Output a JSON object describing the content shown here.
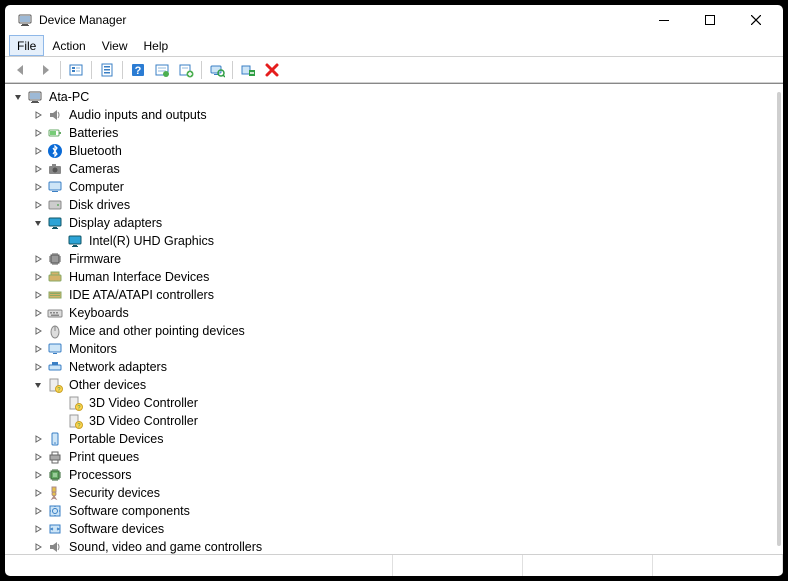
{
  "window": {
    "title": "Device Manager"
  },
  "menus": {
    "file": "File",
    "action": "Action",
    "view": "View",
    "help": "Help"
  },
  "toolbar_icons": [
    "back",
    "forward",
    "show-hidden",
    "properties",
    "help",
    "update",
    "add-legacy",
    "scan",
    "uninstall",
    "disable"
  ],
  "tree": {
    "root": {
      "label": "Ata-PC",
      "expanded": true
    },
    "nodes": [
      {
        "id": "audio",
        "label": "Audio inputs and outputs",
        "icon": "speaker",
        "expanded": false
      },
      {
        "id": "batteries",
        "label": "Batteries",
        "icon": "battery",
        "expanded": false
      },
      {
        "id": "bluetooth",
        "label": "Bluetooth",
        "icon": "bluetooth",
        "expanded": false
      },
      {
        "id": "cameras",
        "label": "Cameras",
        "icon": "camera",
        "expanded": false
      },
      {
        "id": "computer",
        "label": "Computer",
        "icon": "computer",
        "expanded": false
      },
      {
        "id": "diskdrives",
        "label": "Disk drives",
        "icon": "disk",
        "expanded": false
      },
      {
        "id": "display",
        "label": "Display adapters",
        "icon": "display",
        "expanded": true,
        "children": [
          {
            "id": "intelgfx",
            "label": "Intel(R) UHD Graphics",
            "icon": "display"
          }
        ]
      },
      {
        "id": "firmware",
        "label": "Firmware",
        "icon": "chip",
        "expanded": false
      },
      {
        "id": "hid",
        "label": "Human Interface Devices",
        "icon": "hid",
        "expanded": false
      },
      {
        "id": "ide",
        "label": "IDE ATA/ATAPI controllers",
        "icon": "ide",
        "expanded": false
      },
      {
        "id": "keyboards",
        "label": "Keyboards",
        "icon": "keyboard",
        "expanded": false
      },
      {
        "id": "mice",
        "label": "Mice and other pointing devices",
        "icon": "mouse",
        "expanded": false
      },
      {
        "id": "monitors",
        "label": "Monitors",
        "icon": "monitor",
        "expanded": false
      },
      {
        "id": "network",
        "label": "Network adapters",
        "icon": "network",
        "expanded": false
      },
      {
        "id": "other",
        "label": "Other devices",
        "icon": "unknown",
        "expanded": true,
        "children": [
          {
            "id": "3dv1",
            "label": "3D Video Controller",
            "icon": "unknown"
          },
          {
            "id": "3dv2",
            "label": "3D Video Controller",
            "icon": "unknown"
          }
        ]
      },
      {
        "id": "portable",
        "label": "Portable Devices",
        "icon": "portable",
        "expanded": false
      },
      {
        "id": "printqueues",
        "label": "Print queues",
        "icon": "printer",
        "expanded": false
      },
      {
        "id": "processors",
        "label": "Processors",
        "icon": "cpu",
        "expanded": false
      },
      {
        "id": "security",
        "label": "Security devices",
        "icon": "security",
        "expanded": false
      },
      {
        "id": "swcomp",
        "label": "Software components",
        "icon": "swcomp",
        "expanded": false
      },
      {
        "id": "swdev",
        "label": "Software devices",
        "icon": "swdev",
        "expanded": false
      },
      {
        "id": "sound",
        "label": "Sound, video and game controllers",
        "icon": "speaker",
        "expanded": false
      }
    ]
  }
}
